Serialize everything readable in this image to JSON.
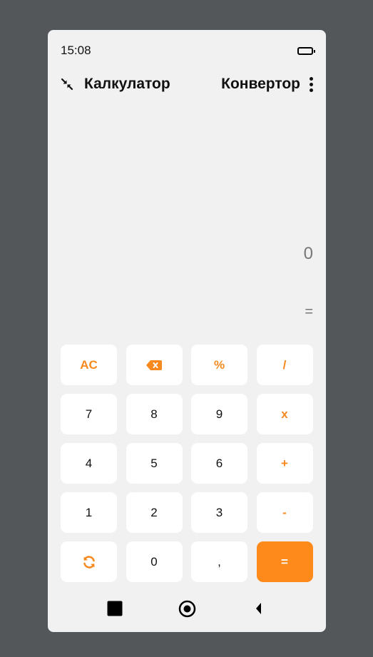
{
  "status_bar": {
    "time": "15:08"
  },
  "header": {
    "calculator_tab": "Калкулатор",
    "converter_tab": "Конвертор"
  },
  "display": {
    "value": "0",
    "equals_sign": "="
  },
  "keypad": {
    "row1": {
      "ac": "AC",
      "percent": "%",
      "divide": "/"
    },
    "row2": {
      "seven": "7",
      "eight": "8",
      "nine": "9",
      "multiply": "x"
    },
    "row3": {
      "four": "4",
      "five": "5",
      "six": "6",
      "plus": "+"
    },
    "row4": {
      "one": "1",
      "two": "2",
      "three": "3",
      "minus": "-"
    },
    "row5": {
      "zero": "0",
      "comma": ",",
      "equals": "="
    }
  },
  "colors": {
    "accent": "#fd8a1a",
    "background": "#f1f1f1",
    "frame": "#53575a",
    "key_background": "#ffffff"
  },
  "icons": {
    "collapse": "collapse-arrows-icon",
    "menu": "more-vertical-icon",
    "backspace": "backspace-icon",
    "swap": "refresh-icon",
    "battery": "battery-icon",
    "nav_recents": "square-icon",
    "nav_home": "circle-icon",
    "nav_back": "triangle-back-icon"
  }
}
